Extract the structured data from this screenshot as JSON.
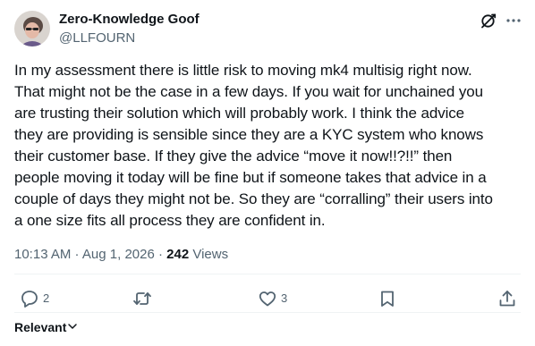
{
  "author": {
    "name": "Zero-Knowledge Goof",
    "handle": "@LLFOURN"
  },
  "tweet": {
    "lines": [
      "In my assessment there is little risk to moving mk4 multisig right now.",
      "That might not be the case in a few days. If you wait for unchained you",
      "are trusting their solution which will probably work. I think the advice",
      "they are providing is sensible since they are a KYC system who knows",
      "their customer base. If they give the advice “move it now!!?!!” then",
      "people moving it today will be fine but if someone takes that advice in a",
      "couple of days they might not be. So they are “corralling” their users into",
      "a one size fits all process they are confident in."
    ]
  },
  "meta": {
    "time": "10:13 AM",
    "sep1": " · ",
    "date": "Aug 1, 2026",
    "sep2": " · ",
    "views_count": "242",
    "views_label": " Views"
  },
  "actions": {
    "reply_count": "2",
    "like_count": "3"
  },
  "sort": {
    "label": "Relevant"
  },
  "icons": {
    "header": [
      "grok-icon",
      "more-icon"
    ],
    "actions": [
      "reply-icon",
      "retweet-icon",
      "like-icon",
      "bookmark-icon",
      "share-icon"
    ],
    "sort": "chevron-down-icon"
  },
  "colors": {
    "text_primary": "#0f1419",
    "text_secondary": "#536471",
    "divider": "#eff3f4"
  }
}
